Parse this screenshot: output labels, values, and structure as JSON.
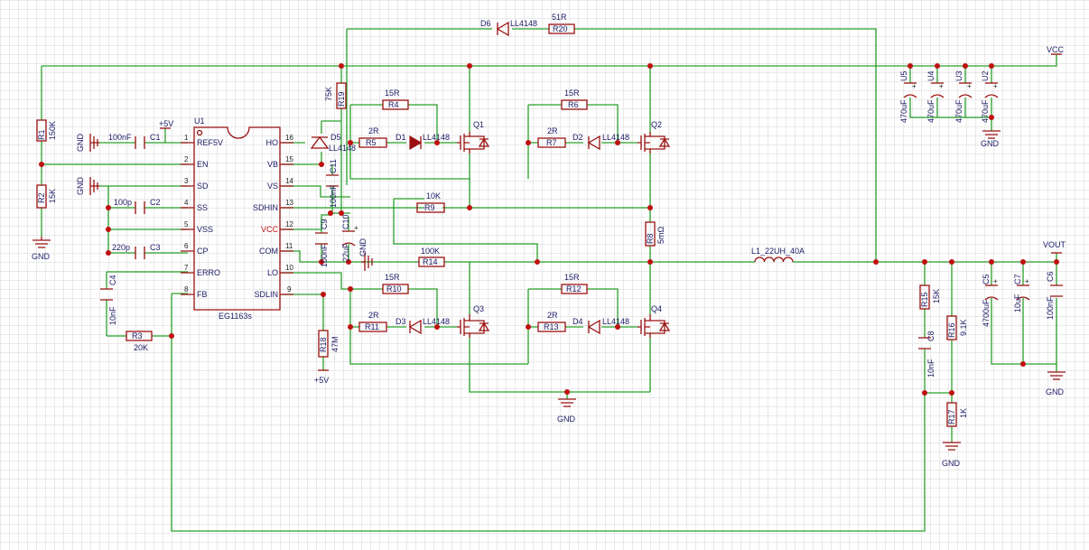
{
  "ic": {
    "ref": "U1",
    "part": "EG1163s",
    "pins_left": [
      {
        "num": "1",
        "name": "REF5V"
      },
      {
        "num": "2",
        "name": "EN"
      },
      {
        "num": "3",
        "name": "SD"
      },
      {
        "num": "4",
        "name": "SS"
      },
      {
        "num": "5",
        "name": "VSS"
      },
      {
        "num": "6",
        "name": "CP"
      },
      {
        "num": "7",
        "name": "ERRO"
      },
      {
        "num": "8",
        "name": "FB"
      }
    ],
    "pins_right": [
      {
        "num": "16",
        "name": "HO"
      },
      {
        "num": "15",
        "name": "VB"
      },
      {
        "num": "14",
        "name": "VS"
      },
      {
        "num": "13",
        "name": "SDHIN"
      },
      {
        "num": "12",
        "name": "VCC"
      },
      {
        "num": "11",
        "name": "COM"
      },
      {
        "num": "10",
        "name": "LO"
      },
      {
        "num": "9",
        "name": "SDLIN"
      }
    ]
  },
  "parts": {
    "r1": {
      "ref": "R1",
      "val": "150K"
    },
    "r2": {
      "ref": "R2",
      "val": "15K"
    },
    "r3": {
      "ref": "R3",
      "val": "20K"
    },
    "r4": {
      "ref": "R4",
      "val": "15R"
    },
    "r5": {
      "ref": "R5",
      "val": "2R"
    },
    "r6": {
      "ref": "R6",
      "val": "15R"
    },
    "r7": {
      "ref": "R7",
      "val": "2R"
    },
    "r8": {
      "ref": "R8",
      "val": "5mΩ"
    },
    "r9": {
      "ref": "R9",
      "val": "10K"
    },
    "r10": {
      "ref": "R10",
      "val": "15R"
    },
    "r11": {
      "ref": "R11",
      "val": "2R"
    },
    "r12": {
      "ref": "R12",
      "val": "15R"
    },
    "r13": {
      "ref": "R13",
      "val": "2R"
    },
    "r14": {
      "ref": "R14",
      "val": "100K"
    },
    "r15": {
      "ref": "R15",
      "val": "15K"
    },
    "r16": {
      "ref": "R16",
      "val": "9.1K"
    },
    "r17": {
      "ref": "R17",
      "val": "1K"
    },
    "r18": {
      "ref": "R18",
      "val": "47M"
    },
    "r19": {
      "ref": "R19",
      "val": "75K"
    },
    "r20": {
      "ref": "R20",
      "val": "51R"
    },
    "c1": {
      "ref": "C1",
      "val": "100nF"
    },
    "c2": {
      "ref": "C2",
      "val": "100p"
    },
    "c3": {
      "ref": "C3",
      "val": "220p"
    },
    "c4": {
      "ref": "C4",
      "val": "10nF"
    },
    "c5": {
      "ref": "C5",
      "val": "4700uF"
    },
    "c6": {
      "ref": "C6",
      "val": "100nF"
    },
    "c7": {
      "ref": "C7",
      "val": "10uF"
    },
    "c8": {
      "ref": "C8",
      "val": "10nF"
    },
    "c9": {
      "ref": "C9",
      "val": "100nF"
    },
    "c10": {
      "ref": "C10",
      "val": "22uF"
    },
    "c11": {
      "ref": "C11",
      "val": "100nF"
    },
    "d1": {
      "ref": "D1",
      "val": "LL4148"
    },
    "d2": {
      "ref": "D2",
      "val": "LL4148"
    },
    "d3": {
      "ref": "D3",
      "val": "LL4148"
    },
    "d4": {
      "ref": "D4",
      "val": "LL4148"
    },
    "d5": {
      "ref": "D5",
      "val": "LL4148"
    },
    "d6": {
      "ref": "D6",
      "val": "LL4148"
    },
    "q1": {
      "ref": "Q1"
    },
    "q2": {
      "ref": "Q2"
    },
    "q3": {
      "ref": "Q3"
    },
    "q4": {
      "ref": "Q4"
    },
    "l1": {
      "ref": "L1_22UH_40A"
    },
    "u2": {
      "ref": "U2",
      "val": "470uF"
    },
    "u3": {
      "ref": "U3",
      "val": "470uF"
    },
    "u4": {
      "ref": "U4",
      "val": "470uF"
    },
    "u5": {
      "ref": "U5",
      "val": "470uF"
    }
  },
  "nets": {
    "vcc": "VCC",
    "vout": "VOUT",
    "gnd": "GND",
    "p5v": "+5V"
  },
  "colors": {
    "wire": "#2aa02a",
    "component": "#9a1010",
    "junction": "#c01010",
    "label": "#1a1a66",
    "grid": "#e9e9e9"
  }
}
